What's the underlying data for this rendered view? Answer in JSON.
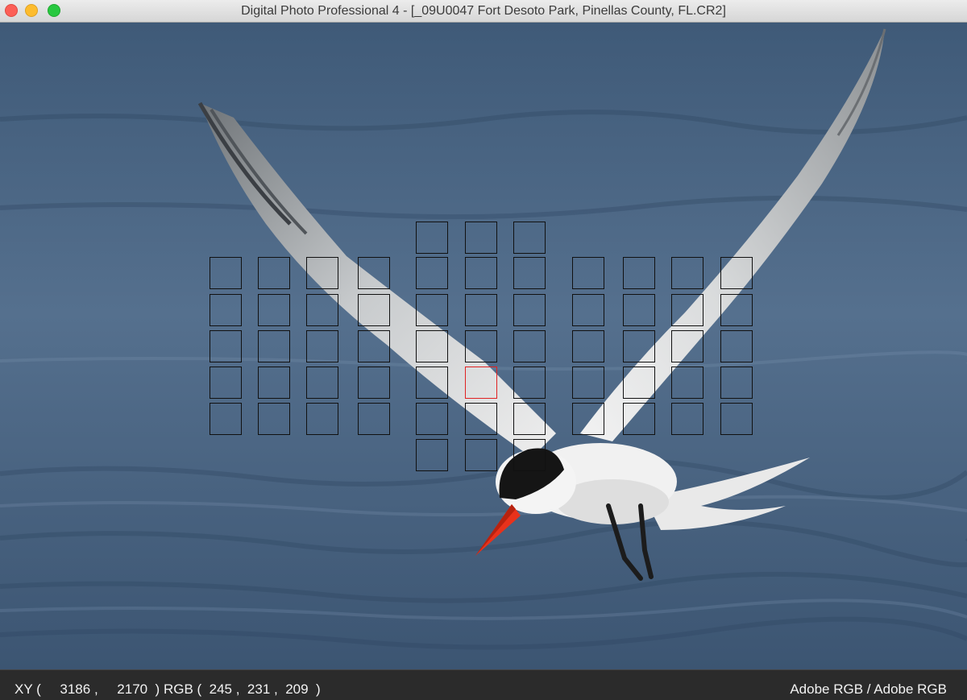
{
  "window": {
    "title": "Digital Photo Professional 4 - [_09U0047  Fort Desoto Park, Pinellas County, FL.CR2]"
  },
  "image": {
    "subject": "tern-in-flight-photo"
  },
  "af_points": {
    "columns": 11,
    "active_point": "center-column-row-5"
  },
  "status": {
    "xy_label": "XY (",
    "x": "3186",
    "y": "2170",
    "rgb_label": "RGB (",
    "r": "245",
    "g": "231",
    "b": "209",
    "color_space": "Adobe RGB / Adobe RGB"
  },
  "colors": {
    "water": "#4b6a8a",
    "active_af": "#e02222",
    "statusbar": "#2b2b2b"
  }
}
